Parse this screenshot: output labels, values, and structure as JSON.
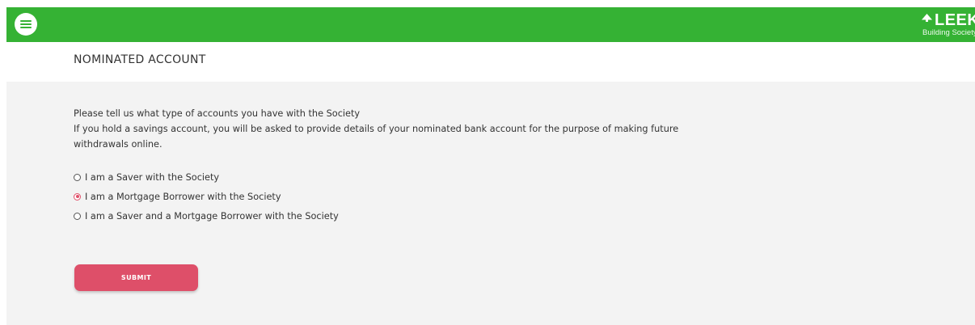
{
  "header": {
    "menu_icon": "hamburger-menu-icon",
    "brand": {
      "name": "LEEK",
      "tagline": "Building Society",
      "logo_icon": "leaf-icon"
    },
    "bg_color": "#35b234"
  },
  "page": {
    "title": "NOMINATED ACCOUNT"
  },
  "form": {
    "intro_line1": "Please tell us what type of accounts you have with the Society",
    "intro_line2": "If you hold a savings account, you will be asked to provide details of your nominated bank account for the purpose of making future withdrawals online.",
    "options": [
      {
        "label": "I am a Saver with the Society",
        "selected": false
      },
      {
        "label": "I am a Mortgage Borrower with the Society",
        "selected": true
      },
      {
        "label": "I am a Saver and a Mortgage Borrower with the Society",
        "selected": false
      }
    ],
    "submit_label": "SUBMIT",
    "accent_color": "#de4f69"
  }
}
